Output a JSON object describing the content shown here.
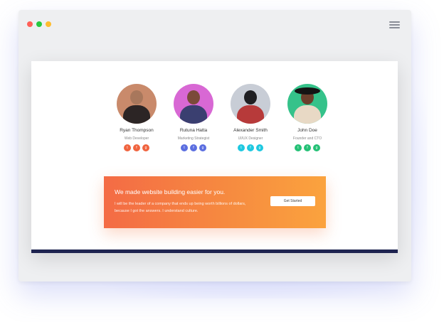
{
  "window": {
    "dots": [
      "#ff5f57",
      "#28c840",
      "#febc2e"
    ]
  },
  "team": [
    {
      "name": "Ryan Thompson",
      "role": "Web Developer",
      "socials": [
        "t",
        "f",
        "g"
      ],
      "colors": {
        "bg": "#c98a6b",
        "head": "#a8775c",
        "body": "#2c2525",
        "social": "#f0643f"
      }
    },
    {
      "name": "Rutuna Hatta",
      "role": "Marketing Strategist",
      "socials": [
        "t",
        "f",
        "g"
      ],
      "colors": {
        "bg": "#d868d4",
        "head": "#7b4a3a",
        "body": "#3a3f70",
        "social": "#5b6ee0"
      }
    },
    {
      "name": "Alexander Smith",
      "role": "UI/UX Designer",
      "socials": [
        "t",
        "f",
        "g"
      ],
      "colors": {
        "bg": "#c8cdd6",
        "head": "#1f1f22",
        "body": "#b73a3a",
        "social": "#1ec8e0"
      }
    },
    {
      "name": "John Doe",
      "role": "Founder and CTO",
      "socials": [
        "t",
        "f",
        "g"
      ],
      "colors": {
        "bg": "#35c28a",
        "head": "#6b3f2c",
        "body": "#e8d9c5",
        "social": "#25c176",
        "hat": "#141414"
      }
    }
  ],
  "cta": {
    "title": "We made website building easier for you.",
    "text": "I will be the leader of a company that ends up being worth billions of dollars, because I got the answers. I understand culture.",
    "button": "Get Started"
  }
}
